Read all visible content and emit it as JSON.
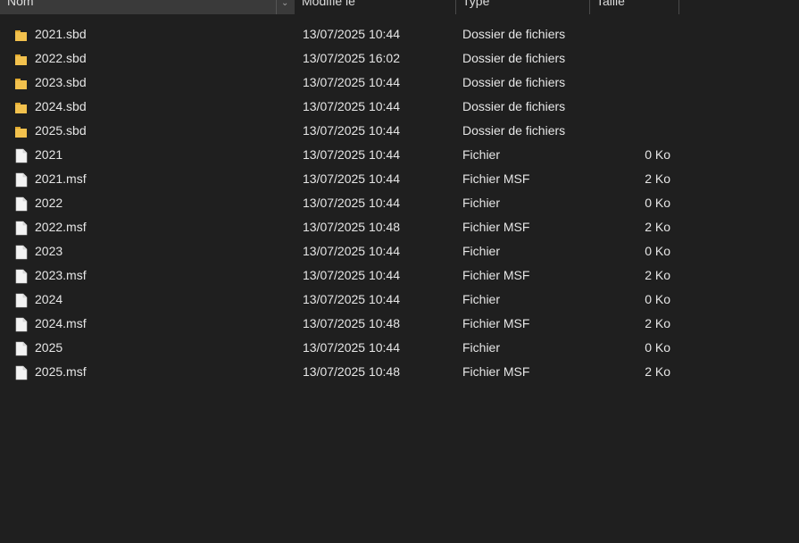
{
  "columns": {
    "name": "Nom",
    "date": "Modifié le",
    "type": "Type",
    "size": "Taille"
  },
  "colors": {
    "background": "#1f1f1f",
    "text": "#e6e6e6",
    "folder": "#f2c14e",
    "file": "#f3f3f3"
  },
  "files": [
    {
      "name": "2021.sbd",
      "date": "13/07/2025 10:44",
      "type": "Dossier de fichiers",
      "size": "",
      "icon": "folder-icon"
    },
    {
      "name": "2022.sbd",
      "date": "13/07/2025 16:02",
      "type": "Dossier de fichiers",
      "size": "",
      "icon": "folder-icon"
    },
    {
      "name": "2023.sbd",
      "date": "13/07/2025 10:44",
      "type": "Dossier de fichiers",
      "size": "",
      "icon": "folder-icon"
    },
    {
      "name": "2024.sbd",
      "date": "13/07/2025 10:44",
      "type": "Dossier de fichiers",
      "size": "",
      "icon": "folder-icon"
    },
    {
      "name": "2025.sbd",
      "date": "13/07/2025 10:44",
      "type": "Dossier de fichiers",
      "size": "",
      "icon": "folder-icon"
    },
    {
      "name": "2021",
      "date": "13/07/2025 10:44",
      "type": "Fichier",
      "size": "0 Ko",
      "icon": "file-icon"
    },
    {
      "name": "2021.msf",
      "date": "13/07/2025 10:44",
      "type": "Fichier MSF",
      "size": "2 Ko",
      "icon": "file-icon"
    },
    {
      "name": "2022",
      "date": "13/07/2025 10:44",
      "type": "Fichier",
      "size": "0 Ko",
      "icon": "file-icon"
    },
    {
      "name": "2022.msf",
      "date": "13/07/2025 10:48",
      "type": "Fichier MSF",
      "size": "2 Ko",
      "icon": "file-icon"
    },
    {
      "name": "2023",
      "date": "13/07/2025 10:44",
      "type": "Fichier",
      "size": "0 Ko",
      "icon": "file-icon"
    },
    {
      "name": "2023.msf",
      "date": "13/07/2025 10:44",
      "type": "Fichier MSF",
      "size": "2 Ko",
      "icon": "file-icon"
    },
    {
      "name": "2024",
      "date": "13/07/2025 10:44",
      "type": "Fichier",
      "size": "0 Ko",
      "icon": "file-icon"
    },
    {
      "name": "2024.msf",
      "date": "13/07/2025 10:48",
      "type": "Fichier MSF",
      "size": "2 Ko",
      "icon": "file-icon"
    },
    {
      "name": "2025",
      "date": "13/07/2025 10:44",
      "type": "Fichier",
      "size": "0 Ko",
      "icon": "file-icon"
    },
    {
      "name": "2025.msf",
      "date": "13/07/2025 10:48",
      "type": "Fichier MSF",
      "size": "2 Ko",
      "icon": "file-icon"
    }
  ]
}
